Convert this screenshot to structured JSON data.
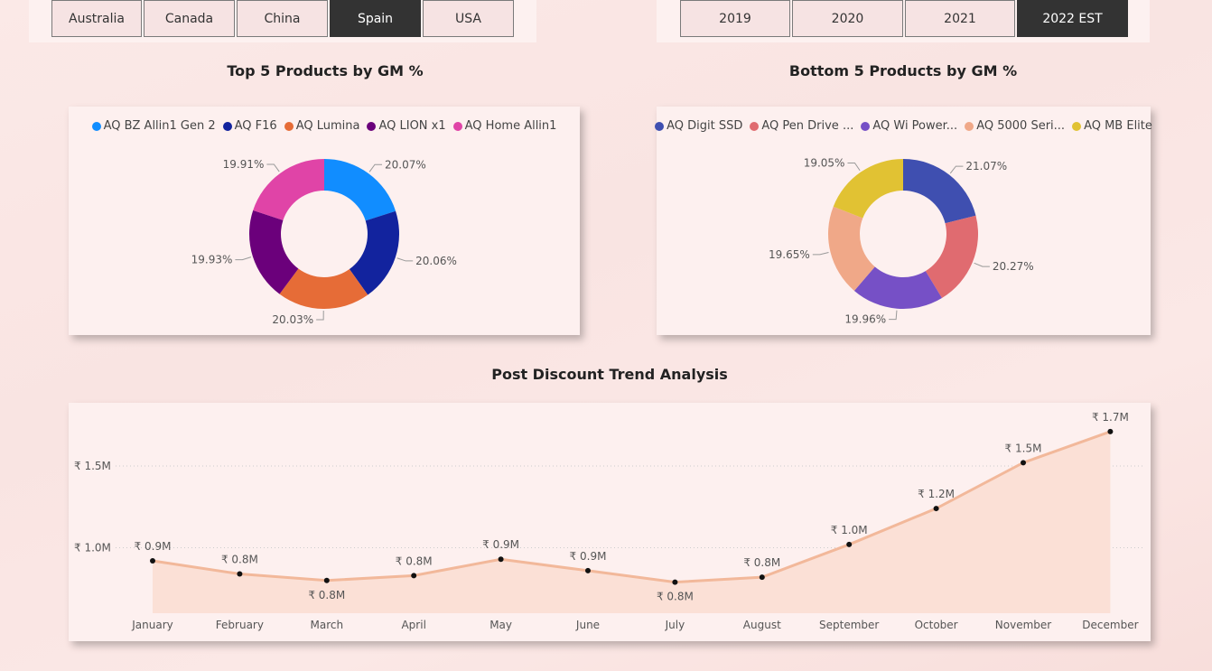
{
  "country_slicer": {
    "options": [
      "Australia",
      "Canada",
      "China",
      "Spain",
      "USA"
    ],
    "selected": "Spain"
  },
  "year_slicer": {
    "options": [
      "2019",
      "2020",
      "2021",
      "2022 EST"
    ],
    "selected": "2022 EST"
  },
  "colors": {
    "top": [
      "#118dff",
      "#12239e",
      "#e66c37",
      "#6b007b",
      "#e044a7"
    ],
    "bottom": [
      "#3f4fb0",
      "#e06b70",
      "#7650c6",
      "#f0a888",
      "#e1c233"
    ],
    "trend_line": "#f2b89a",
    "trend_area": "#fbe0d6"
  },
  "chart_data": [
    {
      "type": "pie",
      "title": "Top 5 Products by GM %",
      "categories": [
        "AQ BZ Allin1 Gen 2",
        "AQ F16",
        "AQ Lumina",
        "AQ LION x1",
        "AQ Home Allin1"
      ],
      "values": [
        20.07,
        20.06,
        20.03,
        19.93,
        19.91
      ],
      "labels": [
        "20.07%",
        "20.06%",
        "20.03%",
        "19.93%",
        "19.91%"
      ],
      "legend": "top"
    },
    {
      "type": "pie",
      "title": "Bottom 5 Products by GM %",
      "categories": [
        "AQ Digit SSD",
        "AQ Pen Drive ...",
        "AQ Wi Power...",
        "AQ 5000 Seri...",
        "AQ MB Elite"
      ],
      "values": [
        21.07,
        20.27,
        19.96,
        19.65,
        19.05
      ],
      "labels": [
        "21.07%",
        "20.27%",
        "19.96%",
        "19.65%",
        "19.05%"
      ],
      "legend": "top"
    },
    {
      "type": "area",
      "title": "Post Discount Trend Analysis",
      "x": [
        "January",
        "February",
        "March",
        "April",
        "May",
        "June",
        "July",
        "August",
        "September",
        "October",
        "November",
        "December"
      ],
      "values": [
        0.92,
        0.84,
        0.8,
        0.83,
        0.93,
        0.86,
        0.79,
        0.82,
        1.02,
        1.24,
        1.52,
        1.71
      ],
      "labels": [
        "₹ 0.9M",
        "₹ 0.8M",
        "₹ 0.8M",
        "₹ 0.8M",
        "₹ 0.9M",
        "₹ 0.9M",
        "₹ 0.8M",
        "₹ 0.8M",
        "₹ 1.0M",
        "₹ 1.2M",
        "₹ 1.5M",
        "₹ 1.7M"
      ],
      "yticks": [
        1.0,
        1.5
      ],
      "ytick_labels": [
        "₹ 1.0M",
        "₹ 1.5M"
      ],
      "ylim": [
        0.6,
        1.82
      ],
      "grid": true
    }
  ]
}
